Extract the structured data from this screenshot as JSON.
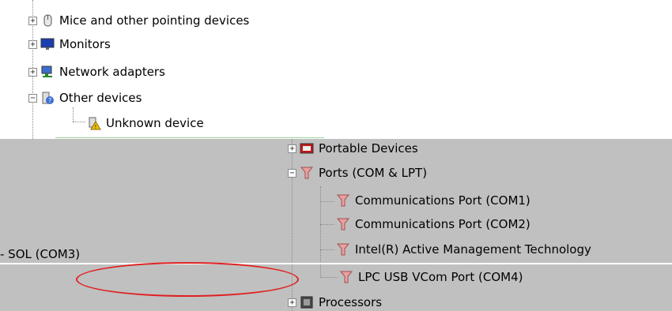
{
  "tree_top": [
    {
      "label": "Mice and other pointing devices",
      "expander": "+",
      "icon": "mouse-icon"
    },
    {
      "label": "Monitors",
      "expander": "+",
      "icon": "monitor-icon"
    },
    {
      "label": "Network adapters",
      "expander": "+",
      "icon": "network-adapter-icon"
    },
    {
      "label": "Other devices",
      "expander": "−",
      "icon": "other-devices-icon"
    },
    {
      "label": "Unknown device",
      "icon": "unknown-device-warning-icon"
    }
  ],
  "tree_bottom": [
    {
      "label": "Portable Devices",
      "expander": "+",
      "icon": "portable-devices-icon"
    },
    {
      "label": "Ports (COM & LPT)",
      "expander": "−",
      "icon": "port-icon"
    },
    {
      "label": "Communications Port (COM1)",
      "icon": "port-icon"
    },
    {
      "label": "Communications Port (COM2)",
      "icon": "port-icon"
    },
    {
      "label": "Intel(R) Active Management Technology",
      "icon": "port-icon"
    },
    {
      "label": "LPC USB VCom Port (COM4)",
      "icon": "port-icon"
    },
    {
      "label": "Processors",
      "expander": "+",
      "icon": "processor-icon"
    }
  ],
  "fragment_text": "- SOL (COM3)",
  "colors": {
    "annotation": "#e02020",
    "overlay_bg": "#c0c0c0"
  }
}
